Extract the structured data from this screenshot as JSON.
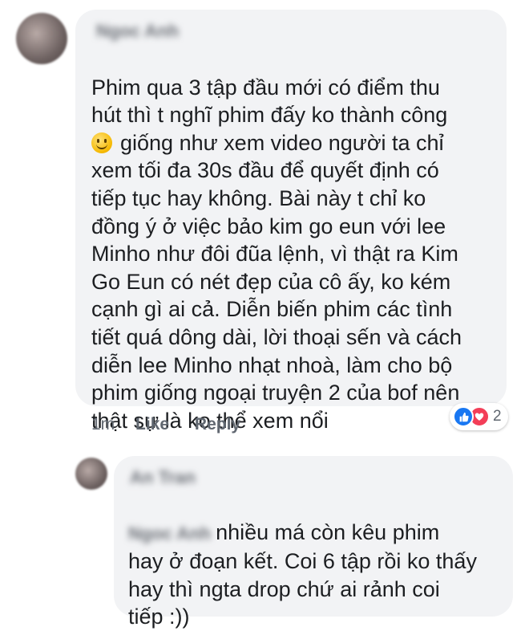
{
  "comment1": {
    "text_lines": "Phim qua 3 tập đầu mới có điểm thu\nhút thì t nghĩ phim đấy ko thành công",
    "text_after_emoji": "giống như xem video người ta chỉ",
    "text_rest": "xem tối đa 30s đầu để quyết định có\ntiếp tục hay không. Bài này t chỉ ko\nđồng ý ở việc bảo kim go eun với lee\nMinho như đôi đũa lệnh, vì thật ra Kim\nGo Eun có nét đẹp của cô ấy, ko kém\ncạnh gì ai cả. Diễn biến phim các tình\ntiết quá dông dài, lời thoại sến và cách\ndiễn lee Minho nhạt nhoà, làm cho bộ\nphim giống ngoại truyện 2 của  bof nên\nthật sự là ko thể xem nổi",
    "emoji_icon": "slightly-smiling-face-icon",
    "time": "1m",
    "like_label": "Like",
    "reply_label": "Reply",
    "reaction_icons": [
      "like-reaction-icon",
      "love-reaction-icon"
    ],
    "reaction_count": "2"
  },
  "comment2": {
    "first_line": "nhiều má còn kêu phim",
    "text_rest": "hay ở đoạn kết. Coi 6 tập rồi ko thấy\nhay thì ngta drop chứ ai rảnh coi\ntiếp :))"
  },
  "colors": {
    "bubble": "#f2f3f5",
    "text": "#1c1e21",
    "meta": "#606770",
    "like_blue": "#1877f2",
    "love_red": "#f33e58"
  }
}
